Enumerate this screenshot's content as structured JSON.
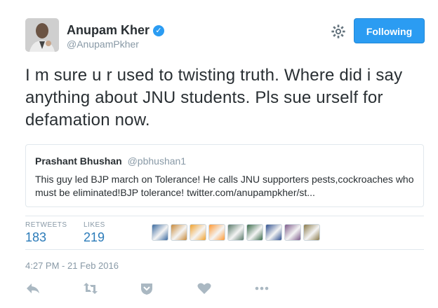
{
  "user": {
    "name": "Anupam Kher",
    "handle": "@AnupamPkher"
  },
  "follow_button": {
    "label": "Following"
  },
  "tweet": {
    "text": "I m sure u r used to twisting truth. Where did i say anything about JNU students. Pls sue urself for defamation now."
  },
  "quoted_tweet": {
    "name": "Prashant Bhushan",
    "handle": "@pbhushan1",
    "text": "This guy led BJP march on Tolerance! He calls JNU supporters pests,cockroaches who must be eliminated!BJP tolerance! twitter.com/anupampkher/st..."
  },
  "stats": {
    "retweets_label": "RETWEETS",
    "retweets_count": "183",
    "likes_label": "LIKES",
    "likes_count": "219"
  },
  "liker_avatar_colors": [
    "#3b6aa0",
    "#c98a3a",
    "#f2a22d",
    "#ff9933",
    "#5a7a6a",
    "#3a6b4a",
    "#2f4f8f",
    "#7d5a8a",
    "#8a7a4a"
  ],
  "timestamp": "4:27 PM - 21 Feb 2016",
  "colors": {
    "accent": "#2b9cf2",
    "link": "#2b7bb9",
    "muted": "#8899a6"
  },
  "icons": [
    "verified-badge-icon",
    "gear-icon",
    "reply-icon",
    "retweet-icon",
    "save-icon",
    "like-icon",
    "more-icon"
  ]
}
